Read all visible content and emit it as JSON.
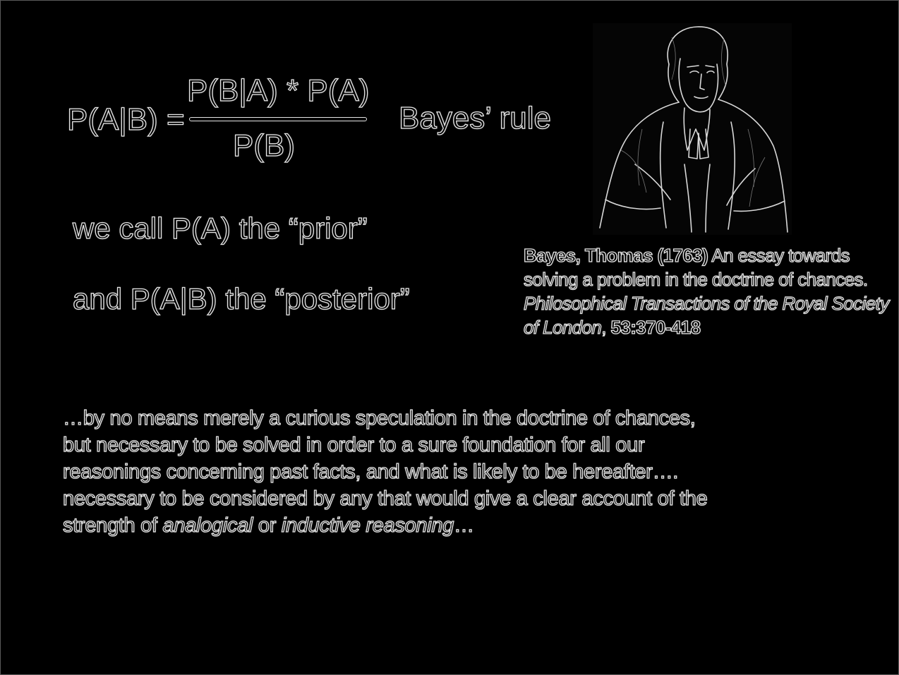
{
  "formula": {
    "lhs": "P(A|B) =",
    "numerator": "P(B|A) * P(A)",
    "denominator": "P(B)",
    "name": "Bayes’ rule"
  },
  "definitions": {
    "prior": "we call P(A) the “prior”",
    "posterior": "and P(A|B) the “posterior”"
  },
  "portrait": {
    "icon": "thomas-bayes-portrait-engraving"
  },
  "citation": {
    "author_year": "Bayes, Thomas (1763)",
    "title": " An essay towards solving a problem in the doctrine of chances. ",
    "journal": "Philosophical Transactions of the Royal Society of London",
    "sep": ", ",
    "pages": "53:370-418"
  },
  "quote": {
    "line1": "…by no means merely a curious speculation in the doctrine of chances,",
    "line2": "but necessary to be solved in order to a sure foundation for all our",
    "line3": "reasonings concerning past facts, and what is likely to be hereafter….",
    "line4": "necessary to be considered by any that would give a clear account of the",
    "line5_start": "strength of ",
    "line5_em1": "analogical",
    "line5_mid": " or ",
    "line5_em2": "inductive reasoning",
    "line5_end": "…"
  },
  "colors": {
    "background": "#000000",
    "stroke": "#e6e6e6"
  }
}
